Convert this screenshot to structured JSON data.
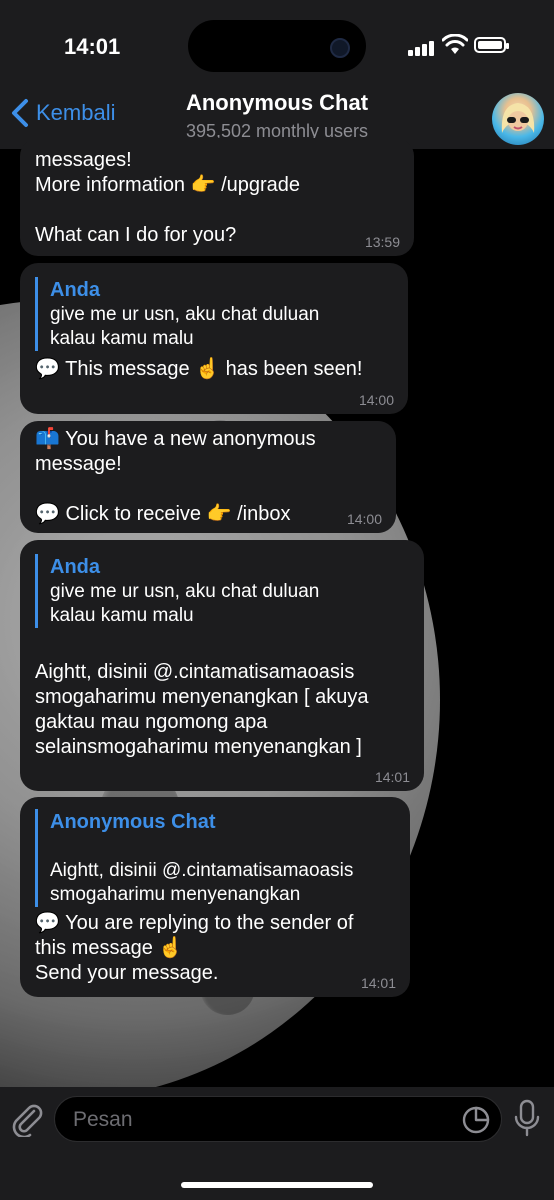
{
  "status_bar": {
    "time": "14:01"
  },
  "header": {
    "back_label": "Kembali",
    "title": "Anonymous Chat",
    "subtitle": "395,502 monthly users"
  },
  "messages": [
    {
      "text": "messages!\nMore information 👉 /upgrade\n\nWhat can I do for you?",
      "time": "13:59"
    },
    {
      "quote_name": "Anda",
      "quote_text": "give me ur usn, aku chat duluan\nkalau kamu malu",
      "text": "💬 This message ☝️ has been seen!",
      "time": "14:00"
    },
    {
      "text": "📫 You have a new anonymous\nmessage!\n\n💬 Click to receive 👉 /inbox",
      "time": "14:00"
    },
    {
      "quote_name": "Anda",
      "quote_text": "give me ur usn, aku chat duluan\nkalau kamu malu",
      "text": "Aightt, disinii @.cintamatisamaoasis\nsmogaharimu menyenangkan [ akuya\ngaktau mau ngomong apa\nselainsmogaharimu menyenangkan ]",
      "time": "14:01"
    },
    {
      "quote_name": "Anonymous Chat",
      "quote_text": "Aightt, disinii @.cintamatisamaoasis\nsmogaharimu menyenangkan",
      "text": "💬 You are replying to the sender of\nthis message ☝️\nSend your message.",
      "time": "14:01"
    }
  ],
  "input": {
    "placeholder": "Pesan"
  },
  "icons": {
    "back": "chevron-left-icon",
    "attach": "paperclip-icon",
    "sticker": "sticker-icon",
    "mic": "microphone-icon"
  },
  "colors": {
    "accent": "#3d8fe8",
    "bubble": "#1c1c1e",
    "muted": "#8d8d93"
  }
}
